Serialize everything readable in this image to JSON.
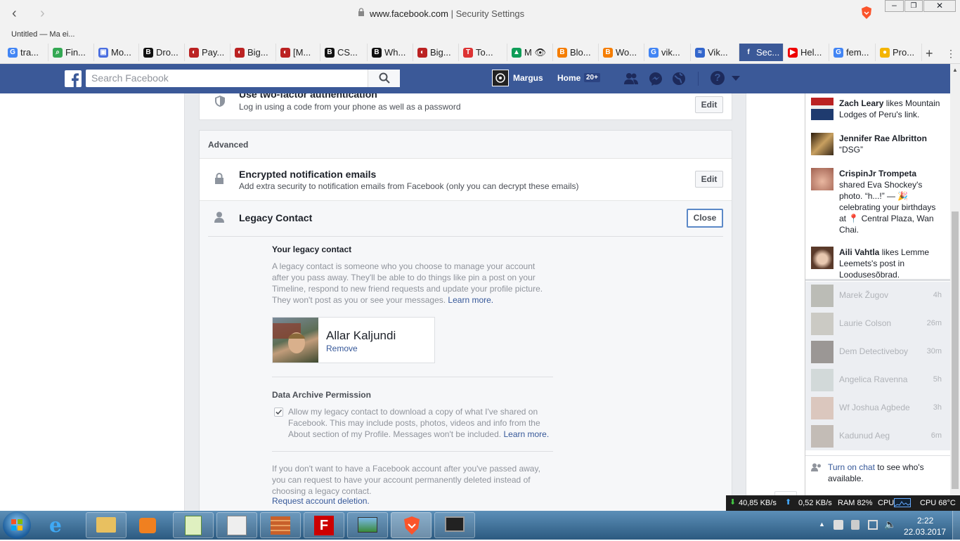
{
  "browser": {
    "url_domain": "www.facebook.com",
    "url_sep": " | ",
    "page_title": "Security Settings",
    "bookmark": "Untitled — Ma ei...",
    "tabs": [
      {
        "label": "tra...",
        "icon": "G",
        "color": "#4285f4"
      },
      {
        "label": "Fin...",
        "icon": "⌕",
        "color": "#34a853"
      },
      {
        "label": "Mo...",
        "icon": "▣",
        "color": "#4a6ee0"
      },
      {
        "label": "Dro...",
        "icon": "B",
        "color": "#111"
      },
      {
        "label": "Pay...",
        "icon": "◐",
        "color": "#b22"
      },
      {
        "label": "Big...",
        "icon": "◐",
        "color": "#b22"
      },
      {
        "label": "[M...",
        "icon": "◐",
        "color": "#b22"
      },
      {
        "label": "CS...",
        "icon": "B",
        "color": "#111"
      },
      {
        "label": "Wh...",
        "icon": "B",
        "color": "#111"
      },
      {
        "label": "Big...",
        "icon": "◐",
        "color": "#b22"
      },
      {
        "label": "To...",
        "icon": "T",
        "color": "#d33"
      },
      {
        "label": "M 👁",
        "icon": "▲",
        "color": "#0f9d58"
      },
      {
        "label": "Blo...",
        "icon": "B",
        "color": "#f57d00"
      },
      {
        "label": "Wo...",
        "icon": "B",
        "color": "#f57d00"
      },
      {
        "label": "vik...",
        "icon": "G",
        "color": "#4285f4"
      },
      {
        "label": "Vik...",
        "icon": "≈",
        "color": "#3366cc"
      },
      {
        "label": "Sec...",
        "icon": "f",
        "color": "#3b5998",
        "active": true
      },
      {
        "label": "Hel...",
        "icon": "▶",
        "color": "#e00"
      },
      {
        "label": "fem...",
        "icon": "G",
        "color": "#4285f4"
      },
      {
        "label": "Pro...",
        "icon": "●",
        "color": "#f4b400"
      }
    ],
    "new_tab": "+"
  },
  "fb": {
    "search_placeholder": "Search Facebook",
    "user_name": "Margus",
    "home_label": "Home",
    "home_badge": "20+"
  },
  "settings": {
    "two_factor": {
      "title": "Use two-factor authentication",
      "desc": "Log in using a code from your phone as well as a password",
      "button": "Edit"
    },
    "advanced_header": "Advanced",
    "encrypted": {
      "title": "Encrypted notification emails",
      "desc": "Add extra security to notification emails from Facebook (only you can decrypt these emails)",
      "button": "Edit"
    },
    "legacy": {
      "title": "Legacy Contact",
      "button": "Close",
      "your_contact_heading": "Your legacy contact",
      "intro": "A legacy contact is someone who you choose to manage your account after you pass away. They'll be able to do things like pin a post on your Timeline, respond to new friend requests and update your profile picture. They won't post as you or see your messages.",
      "learn_more": "Learn more.",
      "contact_name": "Allar Kaljundi",
      "remove": "Remove",
      "archive_heading": "Data Archive Permission",
      "archive_text": "Allow my legacy contact to download a copy of what I've shared on Facebook. This may include posts, photos, videos and info from the About section of my Profile. Messages won't be included.",
      "archive_checked": true,
      "archive_learn_more": "Learn more.",
      "deletion_text": "If you don't want to have a Facebook account after you've passed away, you can request to have your account permanently deleted instead of choosing a legacy contact.",
      "deletion_link": "Request account deletion."
    }
  },
  "ticker": [
    {
      "name": "Zach Leary",
      "rest": " likes Mountain Lodges of Peru's link."
    },
    {
      "name": "Jennifer Rae Albritton",
      "rest": "“DSG”"
    },
    {
      "name": "CrispinJr Trompeta",
      "rest": "shared Eva Shockey's photo. “h...!” — 🎉 celebrating your birthdays at 📍 Central Plaza, Wan Chai."
    },
    {
      "name": "Aili Vahtla",
      "rest": " likes Lemme Leemets's post in Loodusesõbrad."
    }
  ],
  "chat": [
    {
      "name": "Marek Žugov",
      "time": "4h"
    },
    {
      "name": "Laurie Colson",
      "time": "26m"
    },
    {
      "name": "Dem Detectiveboy",
      "time": "30m"
    },
    {
      "name": "Angelica Ravenna",
      "time": "5h"
    },
    {
      "name": "Wf Joshua Agbede",
      "time": "3h"
    },
    {
      "name": "Kadunud Aeg",
      "time": "6m"
    }
  ],
  "chat_footer": {
    "link": "Turn on chat",
    "rest": " to see who's available."
  },
  "sysmon": {
    "down": "40,85 KB/s",
    "up": "0,52 KB/s",
    "ram": "RAM 82%",
    "cpu_label": "CPU",
    "cpu_temp": "CPU 68°C"
  },
  "clock": {
    "time": "2:22",
    "date": "22.03.2017"
  },
  "colors": {
    "fb_blue": "#3b5998",
    "link": "#365899"
  }
}
